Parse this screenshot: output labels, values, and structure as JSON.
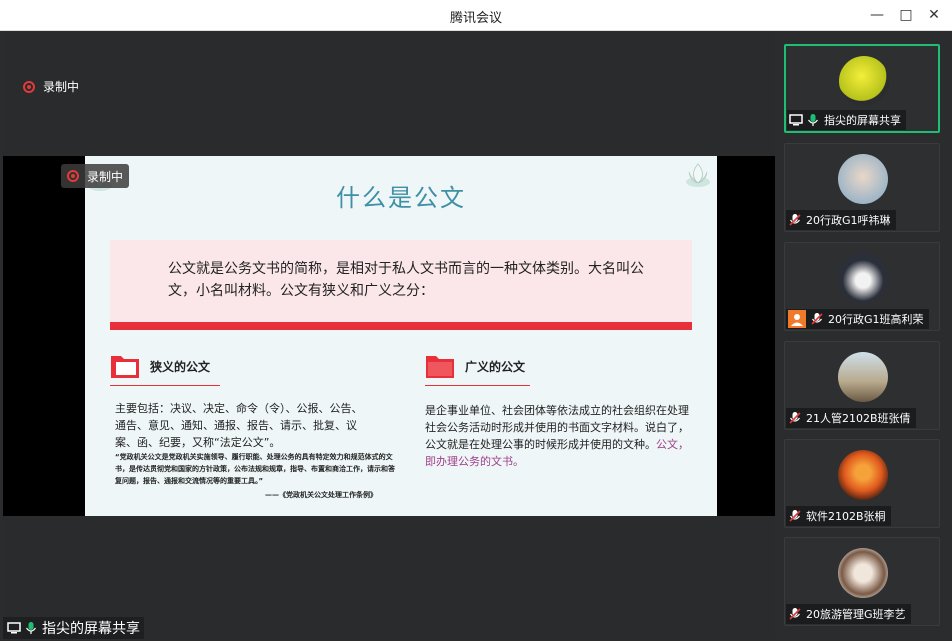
{
  "window": {
    "title": "腾讯会议"
  },
  "recording": {
    "label": "录制中",
    "overlay_label": "录制中"
  },
  "slide": {
    "title": "什么是公文",
    "definition": "公文就是公务文书的简称，是相对于私人文书而言的一种文体类别。大名叫公文，小名叫材料。公文有狭义和广义之分：",
    "narrow": {
      "heading": "狭义的公文",
      "body": "主要包括：决议、决定、命令（令）、公报、公告、通告、意见、通知、通报、报告、请示、批复、议案、函、纪要，又称“法定公文”。",
      "quote": "“党政机关公文是党政机关实施领导、履行职能、处理公务的具有特定效力和规范体式的文书，是传达贯彻党和国家的方针政策，公布法规和规章，指导、布置和商洽工作，请示和答复问题，报告、通报和交流情况等的重要工具。”",
      "source": "——《党政机关公文处理工作条例》"
    },
    "broad": {
      "heading": "广义的公文",
      "body": "是企事业单位、社会团体等依法成立的社会组织在处理社会公务活动时形成并使用的书面文字材料。说白了，公文就是在处理公事的时候形成并使用的文种。",
      "highlight": "公文，即办理公务的文书。"
    }
  },
  "presenter": {
    "label": "指尖的屏幕共享"
  },
  "participants": [
    {
      "name": "指尖的屏幕共享",
      "active": true,
      "sharing": true,
      "mic": "on"
    },
    {
      "name": "20行政G1呼祎琳",
      "active": false,
      "mic": "muted"
    },
    {
      "name": "20行政G1班高利荣",
      "active": false,
      "mic": "muted",
      "badge": "user-icon"
    },
    {
      "name": "21人管2102B班张倩",
      "active": false,
      "mic": "muted"
    },
    {
      "name": "软件2102B张桐",
      "active": false,
      "mic": "muted"
    },
    {
      "name": "20旅游管理G班李艺",
      "active": false,
      "mic": "muted"
    }
  ],
  "colors": {
    "accent_green": "#1dbf73",
    "record_red": "#e23a3a",
    "slide_red": "#e8303a",
    "title_teal": "#3f8fa6",
    "highlight_purple": "#a0418a"
  }
}
